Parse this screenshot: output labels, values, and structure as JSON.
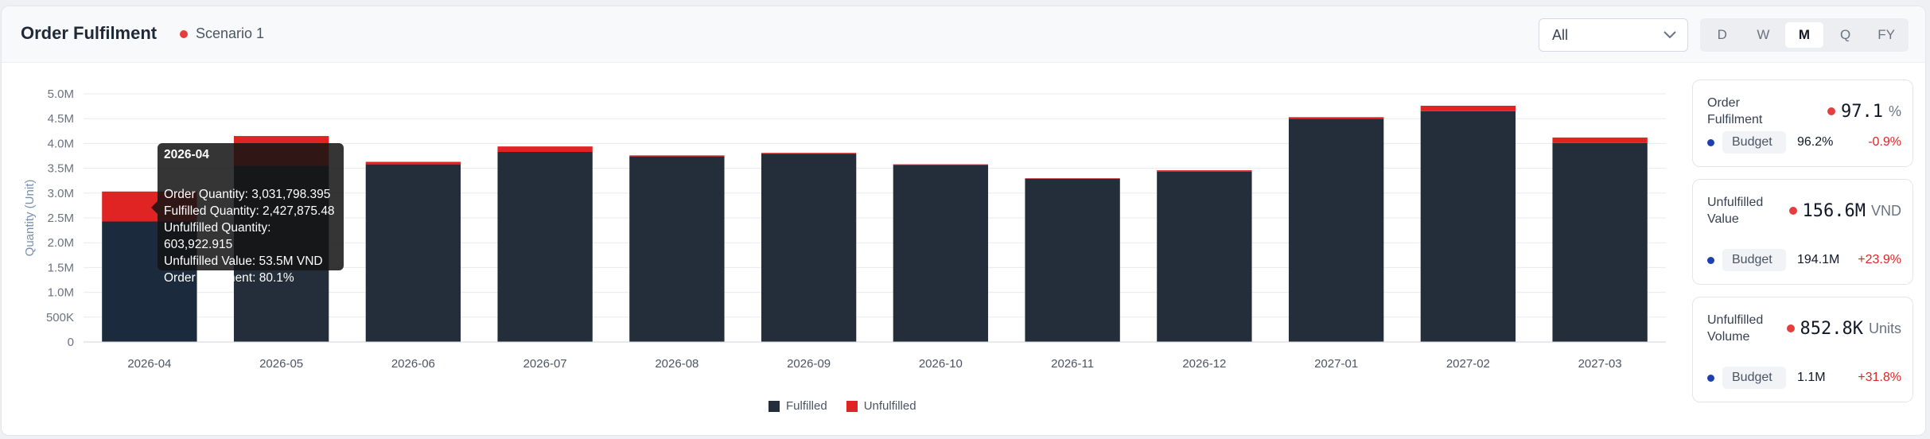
{
  "header": {
    "title": "Order Fulfilment",
    "scenario_label": "Scenario 1",
    "scenario_color": "#e53e3e",
    "filter_value": "All",
    "periods": [
      "D",
      "W",
      "M",
      "Q",
      "FY"
    ],
    "active_period": "M"
  },
  "chart_data": {
    "type": "bar",
    "stacked": true,
    "categories": [
      "2026-04",
      "2026-05",
      "2026-06",
      "2026-07",
      "2026-08",
      "2026-09",
      "2026-10",
      "2026-11",
      "2026-12",
      "2027-01",
      "2027-02",
      "2027-03"
    ],
    "series": [
      {
        "name": "Fulfilled",
        "color": "#242e3a",
        "values": [
          2427875.48,
          3550000,
          3580000,
          3830000,
          3740000,
          3790000,
          3570000,
          3290000,
          3430000,
          4500000,
          4650000,
          4010000
        ]
      },
      {
        "name": "Unfulfilled",
        "color": "#e02424",
        "values": [
          603922.915,
          600000,
          50000,
          110000,
          20000,
          20000,
          10000,
          10000,
          30000,
          30000,
          110000,
          110000
        ]
      }
    ],
    "ylabel": "Quantity (Unit)",
    "ylim": [
      0,
      5000000
    ],
    "yticks": [
      "0",
      "500K",
      "1.0M",
      "1.5M",
      "2.0M",
      "2.5M",
      "3.0M",
      "3.5M",
      "4.0M",
      "4.5M",
      "5.0M"
    ],
    "grid": true,
    "legend_position": "bottom",
    "highlight_index": 0,
    "tooltip": {
      "title": "2026-04",
      "lines": [
        "Order Quantity: 3,031,798.395",
        "Fulfilled Quantity: 2,427,875.48",
        "Unfulfilled Quantity: 603,922.915",
        "Unfulfilled Value: 53.5M VND",
        "Order Fulfilment: 80.1%"
      ]
    }
  },
  "kpis": [
    {
      "label": "Order Fulfilment",
      "value": "97.1",
      "unit": "%",
      "dot_color": "#e53e3e",
      "budget_label": "Budget",
      "budget_value": "96.2%",
      "variance": "-0.9%",
      "budget_dot_color": "#1e40af"
    },
    {
      "label": "Unfulfilled Value",
      "value": "156.6M",
      "unit": "VND",
      "dot_color": "#e53e3e",
      "budget_label": "Budget",
      "budget_value": "194.1M",
      "variance": "+23.9%",
      "budget_dot_color": "#1e40af"
    },
    {
      "label": "Unfulfilled Volume",
      "value": "852.8K",
      "unit": "Units",
      "dot_color": "#e53e3e",
      "budget_label": "Budget",
      "budget_value": "1.1M",
      "variance": "+31.8%",
      "budget_dot_color": "#1e40af"
    }
  ]
}
